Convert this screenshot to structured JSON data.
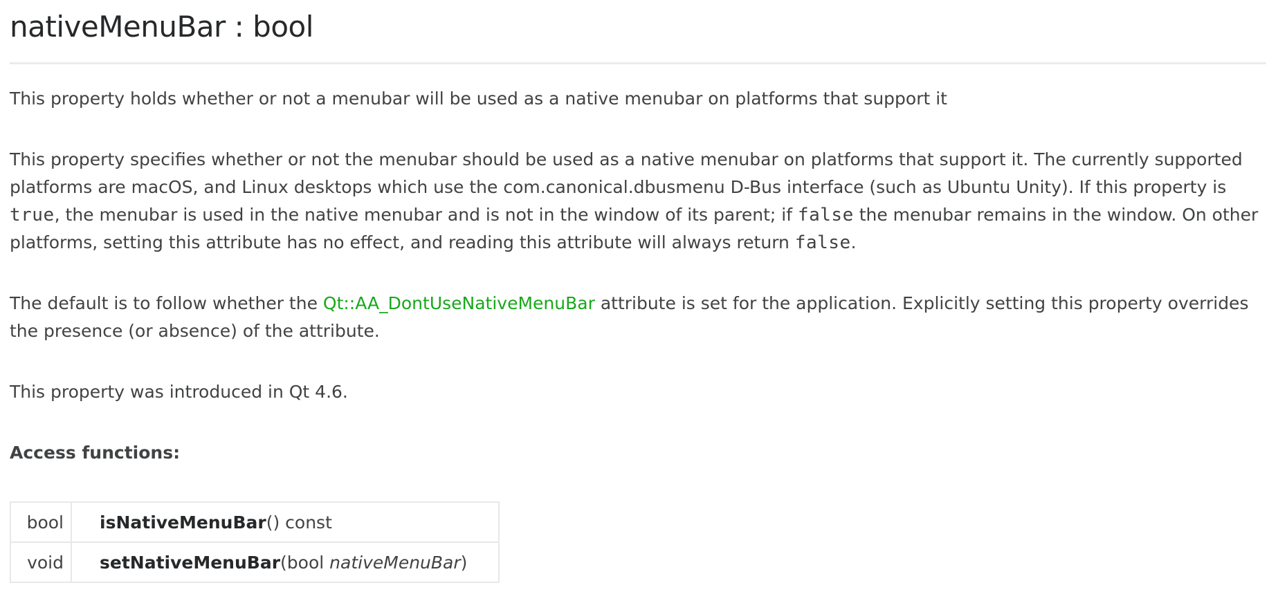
{
  "property": {
    "title": "nativeMenuBar : bool"
  },
  "brief": "This property holds whether or not a menubar will be used as a native menubar on platforms that support it",
  "details": {
    "part1": "This property specifies whether or not the menubar should be used as a native menubar on platforms that support it. The currently supported platforms are macOS, and Linux desktops which use the com.canonical.dbusmenu D-Bus interface (such as Ubuntu Unity). If this property is ",
    "code_true": "true",
    "part2": ", the menubar is used in the native menubar and is not in the window of its parent; if ",
    "code_false1": "false",
    "part3": " the menubar remains in the window. On other platforms, setting this attribute has no effect, and reading this attribute will always return ",
    "code_false2": "false",
    "part4": "."
  },
  "default_para": {
    "before": "The default is to follow whether the ",
    "link": "Qt::AA_DontUseNativeMenuBar",
    "after": " attribute is set for the application. Explicitly setting this property overrides the presence (or absence) of the attribute."
  },
  "since": "This property was introduced in Qt 4.6.",
  "access_heading": "Access functions:",
  "access_functions": [
    {
      "type": "bool",
      "name": "isNativeMenuBar",
      "args_open": "()",
      "suffix": " const"
    },
    {
      "type": "void",
      "name": "setNativeMenuBar",
      "args_open": "(bool ",
      "param": "nativeMenuBar",
      "args_close": ")"
    }
  ],
  "colors": {
    "link": "#17a81a",
    "text": "#404244",
    "heading": "#26282a",
    "rule": "#ebebeb"
  }
}
